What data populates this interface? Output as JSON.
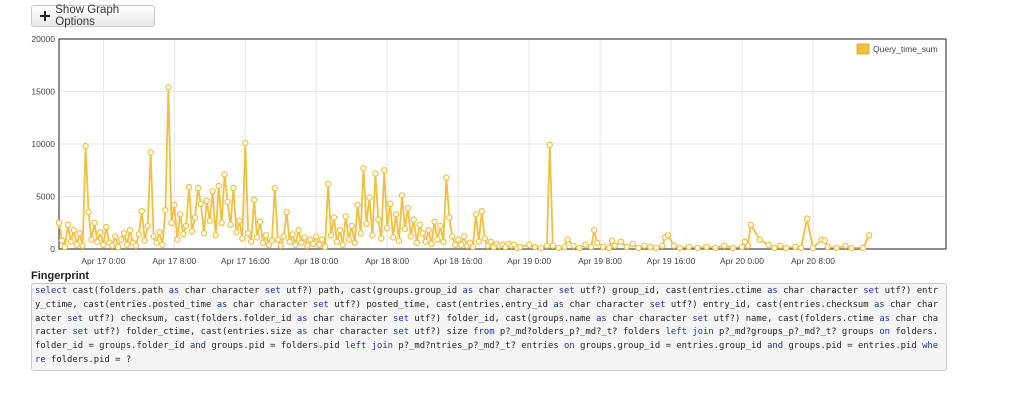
{
  "toolbar": {
    "show_graph_options_label": "Show Graph Options"
  },
  "fingerprint": {
    "label": "Fingerprint",
    "query": "select cast(folders.path as char character set utf?) path, cast(groups.group_id as char character set utf?) group_id, cast(entries.ctime as char character set utf?) entry_ctime, cast(entries.posted_time as char character set utf?) posted_time, cast(entries.entry_id as char character set utf?) entry_id, cast(entries.checksum as char character set utf?) checksum, cast(folders.folder_id as char character set utf?) folder_id, cast(groups.name as char character set utf?) name, cast(folders.ctime as char character set utf?) folder_ctime, cast(entries.size as char character set utf?) size from p?_md?olders_p?_md?_t? folders left join p?_md?groups_p?_md?_t? groups on folders.folder_id = groups.folder_id and groups.pid = folders.pid left join p?_md?ntries_p?_md?_t? entries on groups.group_id = entries.group_id and groups.pid = entries.pid where folders.pid = ?",
    "keywords": [
      "select",
      "as",
      "set",
      "from",
      "left",
      "join",
      "on",
      "and",
      "where"
    ]
  },
  "chart_data": {
    "type": "line",
    "colors": {
      "series": "#f0c040",
      "point_fill": "#ffffff",
      "grid": "#e6e6e6"
    },
    "ylim": [
      0,
      20000
    ],
    "yticks": [
      "0",
      "5000",
      "10000",
      "15000",
      "20000"
    ],
    "xlim": [
      "Apr 16 19:00",
      "Apr 20 23:00"
    ],
    "xticks": [
      "Apr 17 0:00",
      "Apr 17 8:00",
      "Apr 17 16:00",
      "Apr 18 0:00",
      "Apr 18 8:00",
      "Apr 18 16:00",
      "Apr 19 0:00",
      "Apr 19 8:00",
      "Apr 19 16:00",
      "Apr 20 0:00",
      "Apr 20 8:00"
    ],
    "grid": true,
    "legend_position": "top-right",
    "series": [
      {
        "name": "Query_time_sum",
        "points": [
          [
            "Apr 16 19:00",
            2500
          ],
          [
            "Apr 16 19:20",
            800
          ],
          [
            "Apr 16 19:40",
            200
          ],
          [
            "Apr 16 20:00",
            2300
          ],
          [
            "Apr 16 20:20",
            700
          ],
          [
            "Apr 16 20:40",
            1800
          ],
          [
            "Apr 16 21:00",
            400
          ],
          [
            "Apr 16 21:20",
            1500
          ],
          [
            "Apr 16 21:40",
            300
          ],
          [
            "Apr 16 22:00",
            9800
          ],
          [
            "Apr 16 22:20",
            3500
          ],
          [
            "Apr 16 22:40",
            900
          ],
          [
            "Apr 16 23:00",
            2500
          ],
          [
            "Apr 16 23:20",
            700
          ],
          [
            "Apr 16 23:40",
            1600
          ],
          [
            "Apr 17 0:00",
            400
          ],
          [
            "Apr 17 0:20",
            2100
          ],
          [
            "Apr 17 0:40",
            600
          ],
          [
            "Apr 17 1:00",
            300
          ],
          [
            "Apr 17 1:20",
            1200
          ],
          [
            "Apr 17 1:40",
            200
          ],
          [
            "Apr 17 2:00",
            900
          ],
          [
            "Apr 17 2:20",
            1500
          ],
          [
            "Apr 17 2:40",
            400
          ],
          [
            "Apr 17 3:00",
            1800
          ],
          [
            "Apr 17 3:20",
            600
          ],
          [
            "Apr 17 3:40",
            300
          ],
          [
            "Apr 17 4:00",
            1400
          ],
          [
            "Apr 17 4:20",
            3600
          ],
          [
            "Apr 17 4:40",
            800
          ],
          [
            "Apr 17 5:00",
            2200
          ],
          [
            "Apr 17 5:20",
            9200
          ],
          [
            "Apr 17 5:40",
            1200
          ],
          [
            "Apr 17 6:00",
            600
          ],
          [
            "Apr 17 6:20",
            1600
          ],
          [
            "Apr 17 6:40",
            400
          ],
          [
            "Apr 17 7:00",
            3700
          ],
          [
            "Apr 17 7:20",
            15400
          ],
          [
            "Apr 17 7:40",
            2500
          ],
          [
            "Apr 17 8:00",
            4200
          ],
          [
            "Apr 17 8:20",
            900
          ],
          [
            "Apr 17 8:40",
            3300
          ],
          [
            "Apr 17 9:00",
            1400
          ],
          [
            "Apr 17 9:20",
            2200
          ],
          [
            "Apr 17 9:40",
            5900
          ],
          [
            "Apr 17 10:00",
            1700
          ],
          [
            "Apr 17 10:20",
            3000
          ],
          [
            "Apr 17 10:40",
            5800
          ],
          [
            "Apr 17 11:00",
            4300
          ],
          [
            "Apr 17 11:20",
            1500
          ],
          [
            "Apr 17 11:40",
            4600
          ],
          [
            "Apr 17 12:00",
            2700
          ],
          [
            "Apr 17 12:20",
            5500
          ],
          [
            "Apr 17 12:40",
            1300
          ],
          [
            "Apr 17 13:00",
            6000
          ],
          [
            "Apr 17 13:20",
            2500
          ],
          [
            "Apr 17 13:40",
            7100
          ],
          [
            "Apr 17 14:00",
            4500
          ],
          [
            "Apr 17 14:20",
            2300
          ],
          [
            "Apr 17 14:40",
            5800
          ],
          [
            "Apr 17 15:00",
            1600
          ],
          [
            "Apr 17 15:20",
            2700
          ],
          [
            "Apr 17 15:40",
            1000
          ],
          [
            "Apr 17 16:00",
            10100
          ],
          [
            "Apr 17 16:20",
            1500
          ],
          [
            "Apr 17 16:40",
            700
          ],
          [
            "Apr 17 17:00",
            4700
          ],
          [
            "Apr 17 17:20",
            1100
          ],
          [
            "Apr 17 17:40",
            2600
          ],
          [
            "Apr 17 18:00",
            600
          ],
          [
            "Apr 17 18:20",
            1300
          ],
          [
            "Apr 17 18:40",
            400
          ],
          [
            "Apr 17 19:00",
            800
          ],
          [
            "Apr 17 19:20",
            5800
          ],
          [
            "Apr 17 19:40",
            900
          ],
          [
            "Apr 17 20:00",
            300
          ],
          [
            "Apr 17 20:20",
            1200
          ],
          [
            "Apr 17 20:40",
            3500
          ],
          [
            "Apr 17 21:00",
            700
          ],
          [
            "Apr 17 21:20",
            1400
          ],
          [
            "Apr 17 21:40",
            400
          ],
          [
            "Apr 17 22:00",
            1800
          ],
          [
            "Apr 17 22:20",
            600
          ],
          [
            "Apr 17 22:40",
            1100
          ],
          [
            "Apr 17 23:00",
            300
          ],
          [
            "Apr 17 23:20",
            900
          ],
          [
            "Apr 17 23:40",
            500
          ],
          [
            "Apr 18 0:00",
            1200
          ],
          [
            "Apr 18 0:20",
            400
          ],
          [
            "Apr 18 0:40",
            900
          ],
          [
            "Apr 18 1:00",
            200
          ],
          [
            "Apr 18 1:20",
            6200
          ],
          [
            "Apr 18 1:40",
            1300
          ],
          [
            "Apr 18 2:00",
            3000
          ],
          [
            "Apr 18 2:20",
            700
          ],
          [
            "Apr 18 2:40",
            1800
          ],
          [
            "Apr 18 3:00",
            400
          ],
          [
            "Apr 18 3:20",
            3100
          ],
          [
            "Apr 18 3:40",
            900
          ],
          [
            "Apr 18 4:00",
            2200
          ],
          [
            "Apr 18 4:20",
            600
          ],
          [
            "Apr 18 4:40",
            4200
          ],
          [
            "Apr 18 5:00",
            1500
          ],
          [
            "Apr 18 5:20",
            7700
          ],
          [
            "Apr 18 5:40",
            2400
          ],
          [
            "Apr 18 6:00",
            4900
          ],
          [
            "Apr 18 6:20",
            1300
          ],
          [
            "Apr 18 6:40",
            7200
          ],
          [
            "Apr 18 7:00",
            2800
          ],
          [
            "Apr 18 7:20",
            1000
          ],
          [
            "Apr 18 7:40",
            7500
          ],
          [
            "Apr 18 8:00",
            2000
          ],
          [
            "Apr 18 8:20",
            4300
          ],
          [
            "Apr 18 8:40",
            1100
          ],
          [
            "Apr 18 9:00",
            3300
          ],
          [
            "Apr 18 9:20",
            800
          ],
          [
            "Apr 18 9:40",
            5100
          ],
          [
            "Apr 18 10:00",
            1900
          ],
          [
            "Apr 18 10:20",
            3900
          ],
          [
            "Apr 18 10:40",
            1200
          ],
          [
            "Apr 18 11:00",
            2800
          ],
          [
            "Apr 18 11:20",
            600
          ],
          [
            "Apr 18 11:40",
            2300
          ],
          [
            "Apr 18 12:00",
            1500
          ],
          [
            "Apr 18 12:20",
            700
          ],
          [
            "Apr 18 12:40",
            1800
          ],
          [
            "Apr 18 13:00",
            500
          ],
          [
            "Apr 18 13:20",
            2600
          ],
          [
            "Apr 18 13:40",
            900
          ],
          [
            "Apr 18 14:00",
            2200
          ],
          [
            "Apr 18 14:20",
            700
          ],
          [
            "Apr 18 14:40",
            6800
          ],
          [
            "Apr 18 15:00",
            3000
          ],
          [
            "Apr 18 15:20",
            1200
          ],
          [
            "Apr 18 15:40",
            400
          ],
          [
            "Apr 18 16:00",
            900
          ],
          [
            "Apr 18 16:20",
            400
          ],
          [
            "Apr 18 16:40",
            1200
          ],
          [
            "Apr 18 17:00",
            300
          ],
          [
            "Apr 18 17:20",
            600
          ],
          [
            "Apr 18 17:40",
            200
          ],
          [
            "Apr 18 18:00",
            3300
          ],
          [
            "Apr 18 18:20",
            700
          ],
          [
            "Apr 18 18:40",
            3600
          ],
          [
            "Apr 18 19:00",
            1000
          ],
          [
            "Apr 18 19:20",
            300
          ],
          [
            "Apr 18 19:40",
            700
          ],
          [
            "Apr 18 20:00",
            200
          ],
          [
            "Apr 18 20:20",
            500
          ],
          [
            "Apr 18 20:40",
            300
          ],
          [
            "Apr 18 21:00",
            400
          ],
          [
            "Apr 18 21:20",
            200
          ],
          [
            "Apr 18 21:40",
            500
          ],
          [
            "Apr 18 22:00",
            300
          ],
          [
            "Apr 18 22:20",
            400
          ],
          [
            "Apr 18 22:40",
            100
          ],
          [
            "Apr 18 23:00",
            200
          ],
          [
            "Apr 19 0:00",
            400
          ],
          [
            "Apr 19 0:40",
            200
          ],
          [
            "Apr 19 1:20",
            100
          ],
          [
            "Apr 19 2:00",
            300
          ],
          [
            "Apr 19 2:20",
            9900
          ],
          [
            "Apr 19 2:40",
            300
          ],
          [
            "Apr 19 3:20",
            100
          ],
          [
            "Apr 19 4:00",
            200
          ],
          [
            "Apr 19 4:20",
            900
          ],
          [
            "Apr 19 5:00",
            300
          ],
          [
            "Apr 19 5:40",
            100
          ],
          [
            "Apr 19 6:20",
            400
          ],
          [
            "Apr 19 7:00",
            200
          ],
          [
            "Apr 19 7:20",
            1800
          ],
          [
            "Apr 19 7:40",
            600
          ],
          [
            "Apr 19 8:20",
            200
          ],
          [
            "Apr 19 9:00",
            100
          ],
          [
            "Apr 19 9:20",
            800
          ],
          [
            "Apr 19 9:40",
            300
          ],
          [
            "Apr 19 10:20",
            700
          ],
          [
            "Apr 19 11:00",
            200
          ],
          [
            "Apr 19 11:40",
            500
          ],
          [
            "Apr 19 12:20",
            100
          ],
          [
            "Apr 19 13:00",
            300
          ],
          [
            "Apr 19 13:40",
            200
          ],
          [
            "Apr 19 14:20",
            100
          ],
          [
            "Apr 19 15:00",
            300
          ],
          [
            "Apr 19 15:20",
            1100
          ],
          [
            "Apr 19 15:40",
            1300
          ],
          [
            "Apr 19 16:20",
            300
          ],
          [
            "Apr 19 17:00",
            100
          ],
          [
            "Apr 19 18:00",
            200
          ],
          [
            "Apr 19 19:00",
            100
          ],
          [
            "Apr 19 20:00",
            200
          ],
          [
            "Apr 19 21:00",
            100
          ],
          [
            "Apr 19 22:00",
            300
          ],
          [
            "Apr 19 23:00",
            100
          ],
          [
            "Apr 20 0:00",
            200
          ],
          [
            "Apr 20 0:20",
            700
          ],
          [
            "Apr 20 0:40",
            300
          ],
          [
            "Apr 20 1:00",
            2300
          ],
          [
            "Apr 20 2:00",
            900
          ],
          [
            "Apr 20 3:00",
            400
          ],
          [
            "Apr 20 3:40",
            100
          ],
          [
            "Apr 20 4:20",
            300
          ],
          [
            "Apr 20 5:00",
            100
          ],
          [
            "Apr 20 6:00",
            200
          ],
          [
            "Apr 20 6:40",
            100
          ],
          [
            "Apr 20 7:20",
            2900
          ],
          [
            "Apr 20 8:00",
            100
          ],
          [
            "Apr 20 9:00",
            900
          ],
          [
            "Apr 20 9:20",
            800
          ],
          [
            "Apr 20 9:40",
            200
          ],
          [
            "Apr 20 10:40",
            100
          ],
          [
            "Apr 20 11:40",
            300
          ],
          [
            "Apr 20 12:20",
            100
          ],
          [
            "Apr 20 13:40",
            100
          ],
          [
            "Apr 20 14:20",
            1300
          ]
        ]
      }
    ]
  }
}
